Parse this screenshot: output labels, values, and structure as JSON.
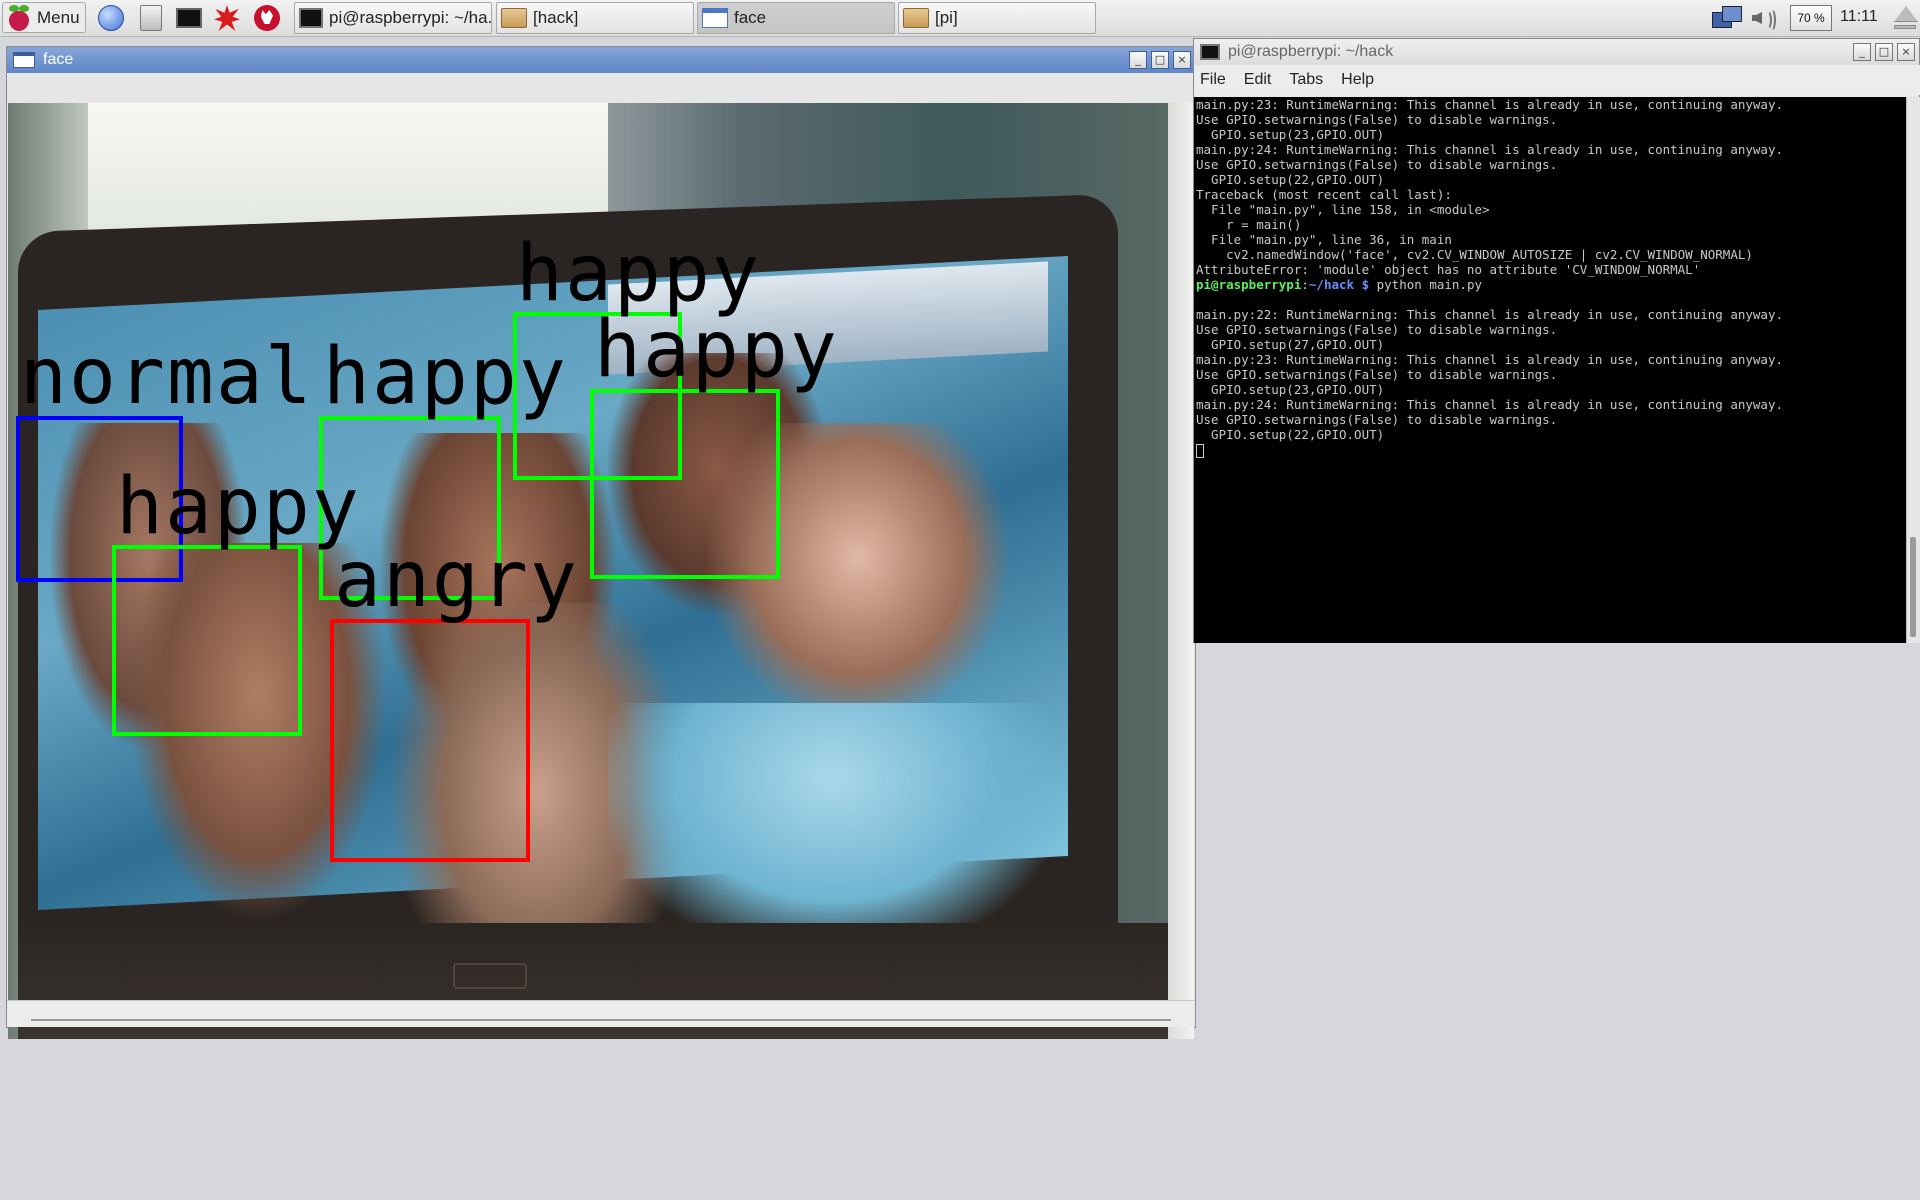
{
  "taskbar": {
    "menu_label": "Menu",
    "launchers": [
      "browser-icon",
      "file-manager-icon",
      "terminal-icon",
      "mathematica-icon",
      "wolfram-icon"
    ],
    "tasks": [
      {
        "label": "pi@raspberrypi: ~/ha...",
        "icon": "terminal-icon",
        "active": false
      },
      {
        "label": "[hack]",
        "icon": "folder-icon",
        "active": false
      },
      {
        "label": "face",
        "icon": "window-icon",
        "active": true
      },
      {
        "label": "[pi]",
        "icon": "folder-icon",
        "active": false
      }
    ],
    "cpu": "70 %",
    "clock": "11:11"
  },
  "face_window": {
    "title": "face",
    "detections": [
      {
        "label": "normal",
        "color": "#0000ff"
      },
      {
        "label": "happy",
        "color": "#00ff00"
      },
      {
        "label": "happy",
        "color": "#00ff00"
      },
      {
        "label": "angry",
        "color": "#ff0000"
      },
      {
        "label": "happy",
        "color": "#00ff00"
      },
      {
        "label": "happy",
        "color": "#00ff00"
      }
    ]
  },
  "terminal": {
    "title": "pi@raspberrypi: ~/hack",
    "menu": [
      "File",
      "Edit",
      "Tabs",
      "Help"
    ],
    "lines_before": [
      "main.py:23: RuntimeWarning: This channel is already in use, continuing anyway.",
      "Use GPIO.setwarnings(False) to disable warnings.",
      "  GPIO.setup(23,GPIO.OUT)",
      "main.py:24: RuntimeWarning: This channel is already in use, continuing anyway.",
      "Use GPIO.setwarnings(False) to disable warnings.",
      "  GPIO.setup(22,GPIO.OUT)",
      "Traceback (most recent call last):",
      "  File \"main.py\", line 158, in <module>",
      "    r = main()",
      "  File \"main.py\", line 36, in main",
      "    cv2.namedWindow('face', cv2.CV_WINDOW_AUTOSIZE | cv2.CV_WINDOW_NORMAL)",
      "AttributeError: 'module' object has no attribute 'CV_WINDOW_NORMAL'"
    ],
    "prompt_user": "pi@raspberrypi",
    "prompt_sep": ":",
    "prompt_path": "~/hack $",
    "command": " python main.py",
    "lines_after": [
      "",
      "main.py:22: RuntimeWarning: This channel is already in use, continuing anyway.",
      "Use GPIO.setwarnings(False) to disable warnings.",
      "  GPIO.setup(27,GPIO.OUT)",
      "main.py:23: RuntimeWarning: This channel is already in use, continuing anyway.",
      "Use GPIO.setwarnings(False) to disable warnings.",
      "  GPIO.setup(23,GPIO.OUT)",
      "main.py:24: RuntimeWarning: This channel is already in use, continuing anyway.",
      "Use GPIO.setwarnings(False) to disable warnings.",
      "  GPIO.setup(22,GPIO.OUT)"
    ]
  }
}
